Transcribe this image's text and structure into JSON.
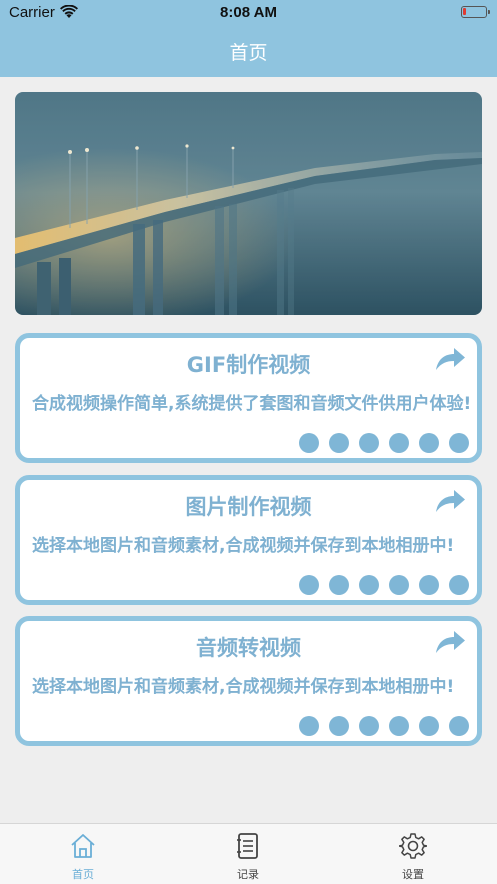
{
  "status_bar": {
    "carrier": "Carrier",
    "time": "8:08 AM",
    "battery": "low"
  },
  "nav": {
    "title": "首页"
  },
  "cards": [
    {
      "title": "GIF制作视频",
      "description": "合成视频操作简单,系统提供了套图和音频文件供用户体验!",
      "icon": "share-arrow-icon"
    },
    {
      "title": "图片制作视频",
      "description": "选择本地图片和音频素材,合成视频并保存到本地相册中!",
      "icon": "share-arrow-icon"
    },
    {
      "title": "音频转视频",
      "description": "选择本地图片和音频素材,合成视频并保存到本地相册中!",
      "icon": "share-arrow-icon"
    }
  ],
  "tabs": [
    {
      "label": "首页",
      "icon": "home-icon",
      "active": true
    },
    {
      "label": "记录",
      "icon": "notebook-icon",
      "active": false
    },
    {
      "label": "设置",
      "icon": "gear-icon",
      "active": false
    }
  ],
  "colors": {
    "accent": "#8fc4df",
    "text_accent": "#7fb1d1",
    "tab_active": "#6aaed6"
  }
}
